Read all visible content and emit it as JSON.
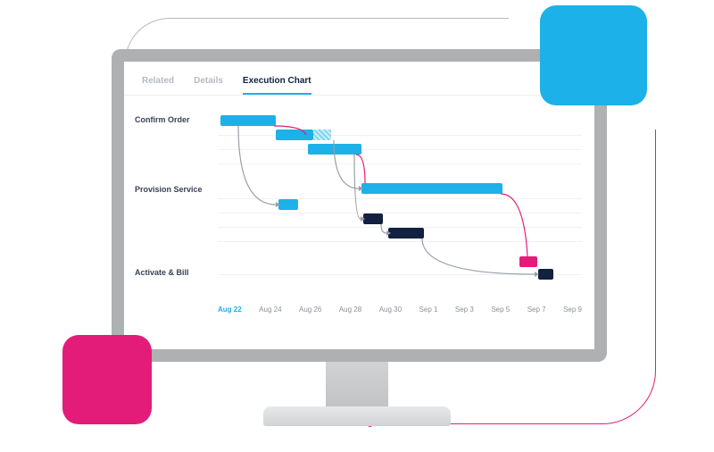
{
  "tabs": {
    "related": "Related",
    "details": "Details",
    "execution": "Execution Chart"
  },
  "rows": {
    "confirm": "Confirm Order",
    "provision": "Provision Service",
    "activate": "Activate & Bill"
  },
  "axis": [
    "Aug 22",
    "Aug 24",
    "Aug 26",
    "Aug 28",
    "Aug 30",
    "Sep 1",
    "Sep 3",
    "Sep 5",
    "Sep 7",
    "Sep 9"
  ],
  "colors": {
    "cyan": "#1cb1e8",
    "navy": "#11213f",
    "pink": "#e31c79"
  },
  "chart_data": {
    "type": "bar",
    "title": "Execution Chart",
    "xlabel": "",
    "ylabel": "",
    "x_range": [
      "Aug 22",
      "Sep 9"
    ],
    "ticks": [
      "Aug 22",
      "Aug 24",
      "Aug 26",
      "Aug 28",
      "Aug 30",
      "Sep 1",
      "Sep 3",
      "Sep 5",
      "Sep 7",
      "Sep 9"
    ],
    "groups": [
      {
        "name": "Confirm Order",
        "tasks": [
          {
            "start": "Aug 22",
            "end": "Aug 25",
            "color": "cyan"
          },
          {
            "start": "Aug 25",
            "end": "Aug 27",
            "color": "cyan"
          },
          {
            "start": "Aug 27",
            "end": "Aug 28",
            "color": "cyan",
            "pattern": "hatched"
          },
          {
            "start": "Aug 27",
            "end": "Aug 30",
            "color": "cyan"
          }
        ]
      },
      {
        "name": "Provision Service",
        "tasks": [
          {
            "start": "Aug 30",
            "end": "Sep 7",
            "color": "cyan"
          },
          {
            "start": "Aug 25",
            "end": "Aug 26",
            "color": "cyan"
          },
          {
            "start": "Aug 30",
            "end": "Aug 31",
            "color": "navy"
          },
          {
            "start": "Sep 1",
            "end": "Sep 3",
            "color": "navy"
          }
        ]
      },
      {
        "name": "Activate & Bill",
        "tasks": [
          {
            "start": "Sep 8",
            "end": "Sep 9",
            "color": "pink"
          },
          {
            "start": "Sep 9",
            "end": "Sep 9.5",
            "color": "navy"
          }
        ]
      }
    ],
    "dependencies": true
  }
}
